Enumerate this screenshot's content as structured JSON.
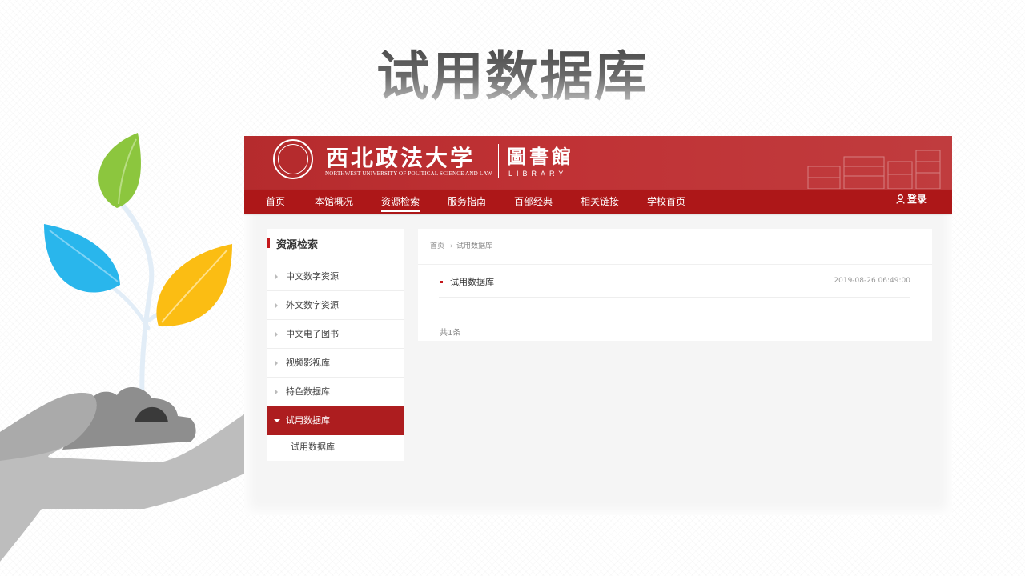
{
  "slide": {
    "title": "试用数据库"
  },
  "banner": {
    "university_name": "西北政法大学",
    "university_en": "NORTHWEST UNIVERSITY OF POLITICAL SCIENCE AND LAW",
    "library_name": "圖書館",
    "library_en": "LIBRARY"
  },
  "nav": {
    "items": [
      {
        "label": "首页"
      },
      {
        "label": "本馆概况"
      },
      {
        "label": "资源检索",
        "active": true
      },
      {
        "label": "服务指南"
      },
      {
        "label": "百部经典"
      },
      {
        "label": "相关链接"
      },
      {
        "label": "学校首页"
      }
    ],
    "login_label": "登录"
  },
  "sidebar": {
    "title": "资源检索",
    "items": [
      {
        "label": "中文数字资源"
      },
      {
        "label": "外文数字资源"
      },
      {
        "label": "中文电子图书"
      },
      {
        "label": "视频影视库"
      },
      {
        "label": "特色数据库"
      },
      {
        "label": "试用数据库",
        "active": true
      }
    ],
    "sub_items": [
      {
        "label": "试用数据库"
      }
    ]
  },
  "breadcrumb": {
    "home": "首页",
    "separator": "›",
    "current": "试用数据库"
  },
  "list": {
    "rows": [
      {
        "title": "试用数据库",
        "date": "2019-08-26 06:49:00"
      }
    ],
    "total": "共1条"
  },
  "colors": {
    "primary_red": "#ad1718",
    "banner_red": "#b52b2d",
    "accent_red": "#c4171b"
  }
}
